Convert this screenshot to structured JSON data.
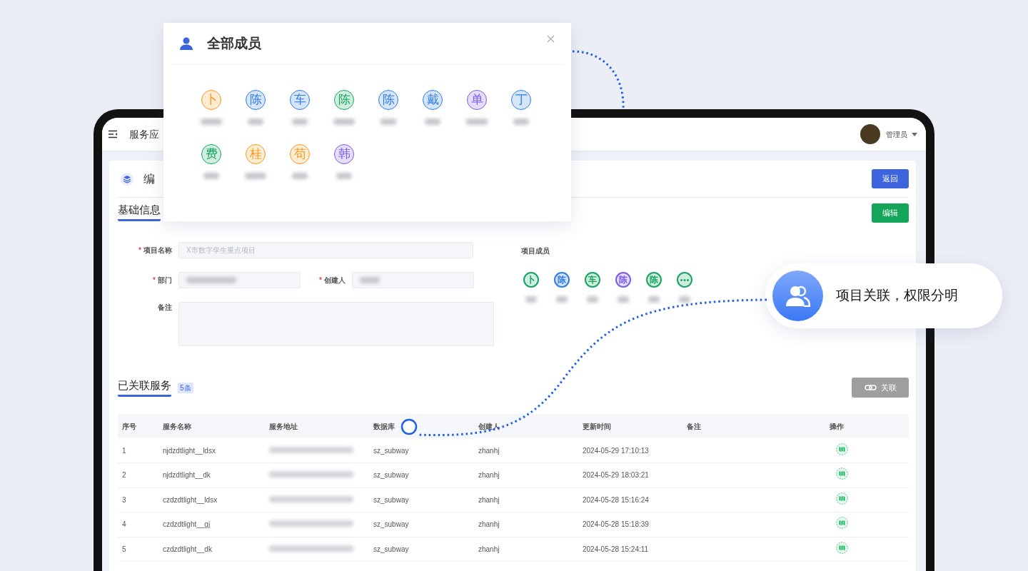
{
  "popup": {
    "title": "全部成员",
    "members": [
      {
        "initial": "卜",
        "color": "#f39a1e"
      },
      {
        "initial": "陈",
        "color": "#2f7be5"
      },
      {
        "initial": "车",
        "color": "#2f7be5"
      },
      {
        "initial": "陈",
        "color": "#16a560"
      },
      {
        "initial": "陈",
        "color": "#2f7be5"
      },
      {
        "initial": "戴",
        "color": "#2f7be5"
      },
      {
        "initial": "单",
        "color": "#7b5ce8"
      },
      {
        "initial": "丁",
        "color": "#2f7be5"
      },
      {
        "initial": "费",
        "color": "#16a560"
      },
      {
        "initial": "桂",
        "color": "#f39a1e"
      },
      {
        "initial": "苟",
        "color": "#f39a1e"
      },
      {
        "initial": "韩",
        "color": "#7b5ce8"
      }
    ]
  },
  "callout": {
    "text": "项目关联，权限分明"
  },
  "header": {
    "title": "服务应",
    "user": "管理员"
  },
  "page": {
    "title": "编",
    "back_button": "返回"
  },
  "basic_info": {
    "title": "基础信息",
    "edit_button": "编辑",
    "required_mark": "*",
    "fields": [
      {
        "label": "项目名称",
        "required": true,
        "placeholder": "X市数字孪生重点项目",
        "blurred_value": false,
        "kind": "input"
      },
      {
        "label": "部门",
        "required": true,
        "blurred_value": true,
        "kind": "input"
      },
      {
        "label": "创建人",
        "required": true,
        "blurred_value": true,
        "kind": "input"
      },
      {
        "label": "备注",
        "required": false,
        "blurred_value": false,
        "kind": "textarea"
      }
    ],
    "members_label": "项目成员",
    "members": [
      {
        "kind": "person",
        "initial": "卜",
        "color": "#16a560"
      },
      {
        "kind": "person",
        "initial": "陈",
        "color": "#2f7be5"
      },
      {
        "kind": "person",
        "initial": "车",
        "color": "#16a560"
      },
      {
        "kind": "person",
        "initial": "陈",
        "color": "#7b5ce8"
      },
      {
        "kind": "person",
        "initial": "陈",
        "color": "#16a560"
      },
      {
        "kind": "more",
        "color": "#16a560"
      }
    ]
  },
  "services": {
    "title": "已关联服务",
    "count": "5条",
    "link_button": "关联",
    "columns": [
      "序号",
      "服务名称",
      "服务地址",
      "数据库",
      "创建人",
      "更新时间",
      "备注",
      "操作"
    ],
    "rows": [
      {
        "index": "1",
        "name": "njdzdtlight__ldsx",
        "database": "sz_subway",
        "creator": "zhanhj",
        "updated": "2024-05-29 17:10:13"
      },
      {
        "index": "2",
        "name": "njdzdtlight__dk",
        "database": "sz_subway",
        "creator": "zhanhj",
        "updated": "2024-05-29 18:03:21"
      },
      {
        "index": "3",
        "name": "czdzdtlight__ldsx",
        "database": "sz_subway",
        "creator": "zhanhj",
        "updated": "2024-05-28 15:16:24"
      },
      {
        "index": "4",
        "name": "czdzdtlight__gj",
        "database": "sz_subway",
        "creator": "zhanhj",
        "updated": "2024-05-28 15:18:39"
      },
      {
        "index": "5",
        "name": "czdzdtlight__dk",
        "database": "sz_subway",
        "creator": "zhanhj",
        "updated": "2024-05-28 15:24:11"
      }
    ]
  }
}
